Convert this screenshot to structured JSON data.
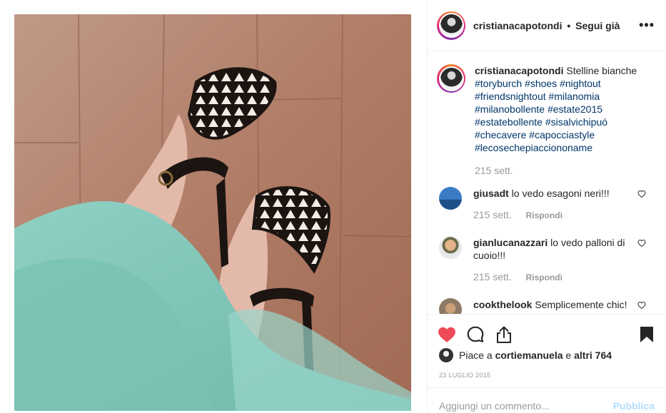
{
  "post": {
    "username": "cristianacapotondi",
    "follow_label": "Segui già",
    "separator": "•",
    "more_label": "•••"
  },
  "caption": {
    "username": "cristianacapotondi",
    "text": "Stelline bianche",
    "hashtags": [
      "#toryburch",
      "#shoes",
      "#nightout",
      "#friendsnightout",
      "#milanomia",
      "#milanobollente",
      "#estate2015",
      "#estatebollente",
      "#sisalvichipuó",
      "#checavere",
      "#capocciastyle",
      "#lecosechepiacciononame"
    ],
    "time": "215 sett."
  },
  "comments": [
    {
      "username": "giusadt",
      "text": "lo vedo esagoni neri!!!",
      "time": "215 sett.",
      "reply_label": "Rispondi"
    },
    {
      "username": "gianlucanazzari",
      "text": "lo vedo palloni di cuoio!!!",
      "time": "215 sett.",
      "reply_label": "Rispondi"
    },
    {
      "username": "cookthelook",
      "text": "Semplicemente chic!"
    }
  ],
  "likes": {
    "prefix": "Piace a",
    "user": "cortiemanuela",
    "middle": "e",
    "others": "altri 764"
  },
  "date": "23 LUGLIO 2015",
  "comment_input": {
    "placeholder": "Aggiungi un commento..."
  },
  "publish_label": "Pubblica",
  "colors": {
    "like_red": "#ed4956",
    "link_blue": "#003569",
    "muted_gray": "#999999",
    "publish_disabled": "#b2dffc"
  },
  "icons": [
    "more-icon",
    "heart-filled-icon",
    "comment-icon",
    "share-icon",
    "bookmark-filled-icon",
    "heart-outline-icon"
  ]
}
